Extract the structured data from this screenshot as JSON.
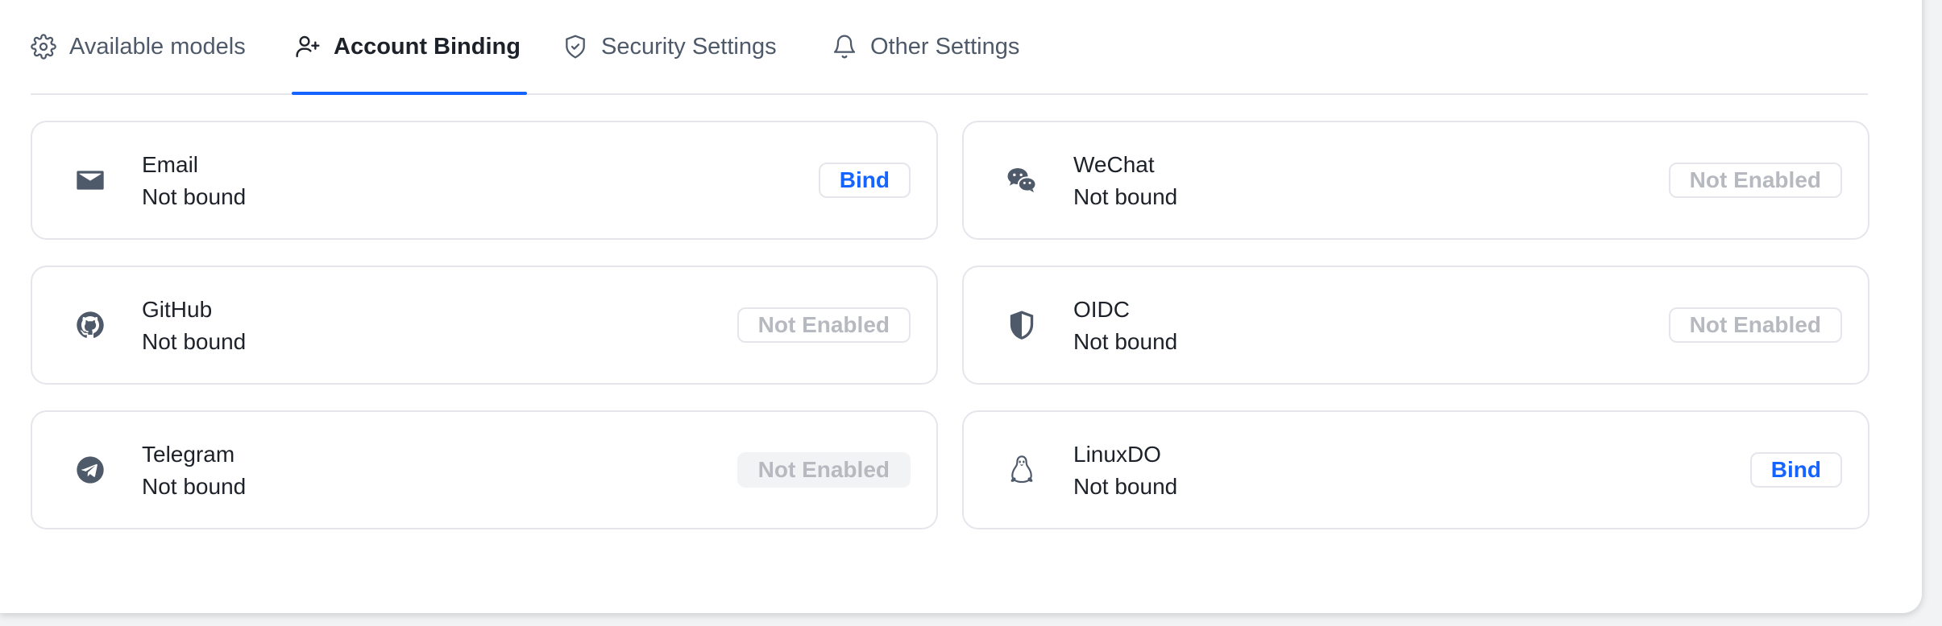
{
  "tabs": [
    {
      "label": "Available models",
      "icon": "gear-icon",
      "active": false
    },
    {
      "label": "Account Binding",
      "icon": "user-plus-icon",
      "active": true
    },
    {
      "label": "Security Settings",
      "icon": "shield-check-icon",
      "active": false
    },
    {
      "label": "Other Settings",
      "icon": "bell-icon",
      "active": false
    }
  ],
  "bindings": [
    {
      "name": "Email",
      "status": "Not bound",
      "action": "Bind",
      "icon": "mail-icon"
    },
    {
      "name": "WeChat",
      "status": "Not bound",
      "action": "Not Enabled",
      "icon": "wechat-icon"
    },
    {
      "name": "GitHub",
      "status": "Not bound",
      "action": "Not Enabled",
      "icon": "github-icon"
    },
    {
      "name": "OIDC",
      "status": "Not bound",
      "action": "Not Enabled",
      "icon": "shield-icon"
    },
    {
      "name": "Telegram",
      "status": "Not bound",
      "action": "Not Enabled",
      "icon": "telegram-icon"
    },
    {
      "name": "LinuxDO",
      "status": "Not bound",
      "action": "Bind",
      "icon": "linux-icon"
    }
  ],
  "colors": {
    "accent": "#1664ff",
    "text": "#1d2129",
    "muted": "#4e5969",
    "disabled_text": "#b6b9bf",
    "border": "#e5e6eb"
  }
}
